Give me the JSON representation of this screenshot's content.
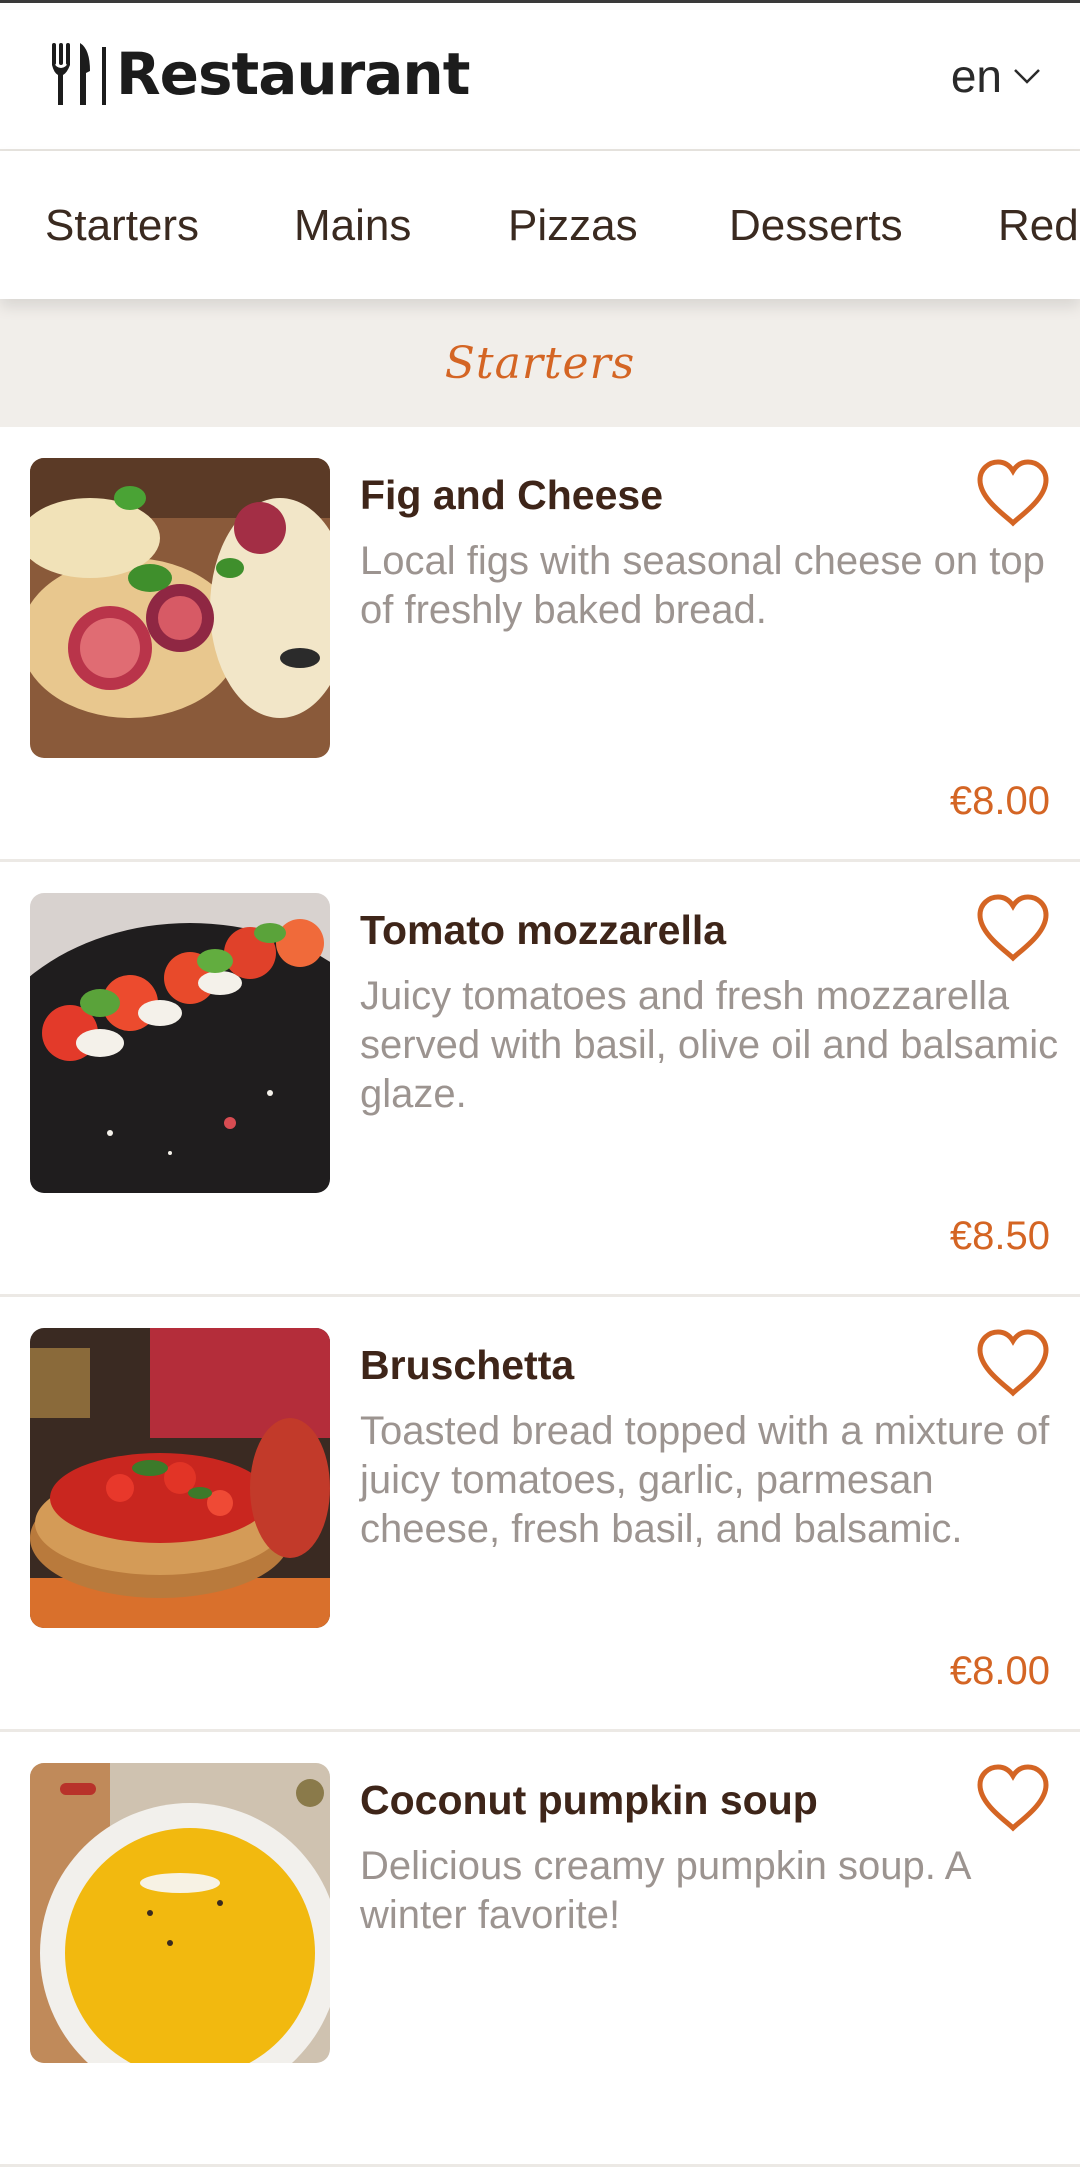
{
  "header": {
    "brand": "Restaurant",
    "language": "en",
    "icons": {
      "logo": "fork-knife-icon",
      "language_toggle": "chevron-down-icon"
    }
  },
  "nav": {
    "tabs": [
      "Starters",
      "Mains",
      "Pizzas",
      "Desserts",
      "Red"
    ]
  },
  "section": {
    "title": "Starters"
  },
  "menu": {
    "items": [
      {
        "name": "Fig and Cheese",
        "description": "Local figs with seasonal cheese on top of freshly baked bread.",
        "price": "€8.00",
        "image": "fig-and-cheese-photo"
      },
      {
        "name": "Tomato mozzarella",
        "description": "Juicy tomatoes and fresh mozzarella served with basil, olive oil and balsamic glaze.",
        "price": "€8.50",
        "image": "tomato-mozzarella-photo"
      },
      {
        "name": "Bruschetta",
        "description": "Toasted bread topped with a mixture of juicy tomatoes, garlic, parmesan cheese, fresh basil, and balsamic.",
        "price": "€8.00",
        "image": "bruschetta-photo"
      },
      {
        "name": "Coconut pumpkin soup",
        "description": "Delicious creamy pumpkin soup. A winter favorite!",
        "price": "",
        "image": "pumpkin-soup-photo"
      }
    ]
  },
  "colors": {
    "accent": "#d46524",
    "title_text": "#3e2519",
    "description_text": "#9c9490",
    "section_background": "#f1eeea"
  }
}
